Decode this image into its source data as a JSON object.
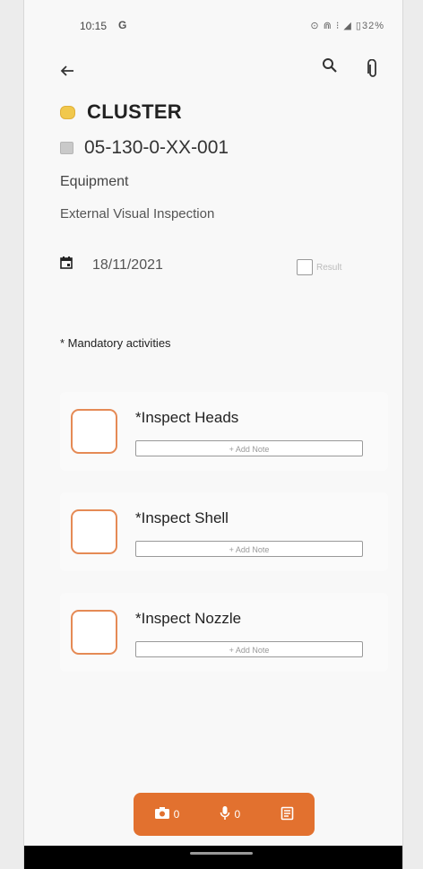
{
  "status": {
    "time": "10:15",
    "g": "G",
    "right": "⊙ ⋒ ⁝ ◢ ▯32%"
  },
  "header": {
    "cluster": "CLUSTER",
    "code": "05-130-0-XX-001",
    "category": "Equipment",
    "inspection_type": "External Visual Inspection",
    "date": "18/11/2021",
    "result_label": "Result"
  },
  "mandatory_note": "* Mandatory activities",
  "activities": [
    {
      "title": "*Inspect Heads",
      "add_note": "+ Add Note"
    },
    {
      "title": "*Inspect Shell",
      "add_note": "+ Add Note"
    },
    {
      "title": "*Inspect Nozzle",
      "add_note": "+ Add Note"
    }
  ],
  "bottom_bar": {
    "photos_count": "0",
    "audio_count": "0"
  },
  "colors": {
    "accent": "#e2712f",
    "checkbox_border": "#e58a55",
    "cluster_dot": "#f1c84c"
  },
  "icons": [
    "back-arrow-icon",
    "search-icon",
    "paperclip-icon",
    "calendar-icon",
    "camera-icon",
    "microphone-icon",
    "note-icon"
  ]
}
